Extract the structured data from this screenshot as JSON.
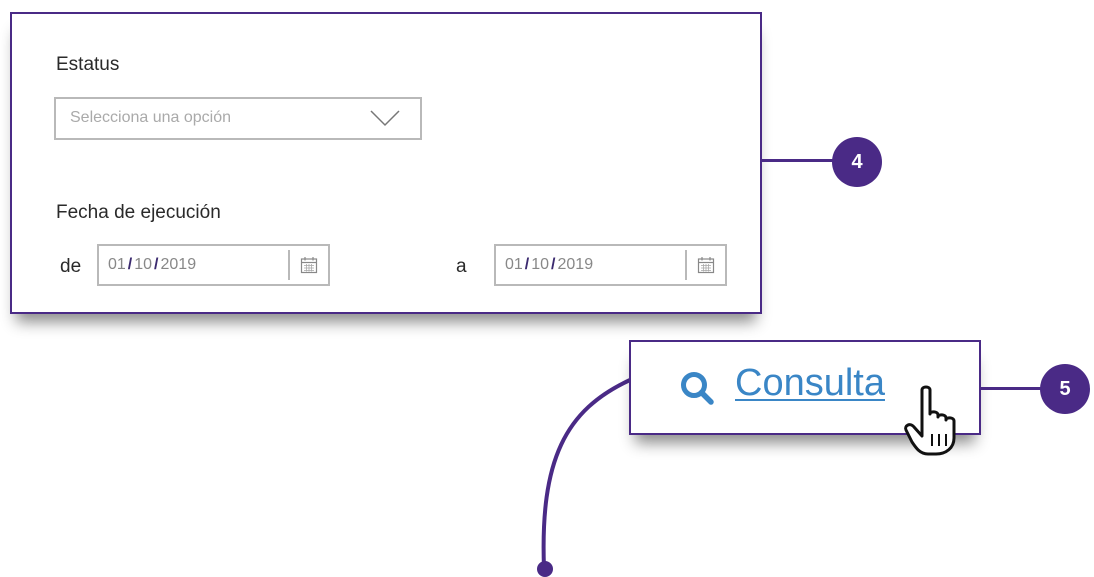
{
  "filters": {
    "status_label": "Estatus",
    "status_placeholder": "Selecciona una opción",
    "date_label": "Fecha de ejecución",
    "from_label": "de",
    "to_label": "a",
    "from_date": {
      "day": "01",
      "month": "10",
      "year": "2019",
      "separator": "/"
    },
    "to_date": {
      "day": "01",
      "month": "10",
      "year": "2019",
      "separator": "/"
    }
  },
  "callouts": {
    "step_4": "4",
    "step_5": "5"
  },
  "consulta": {
    "label": "Consulta"
  },
  "colors": {
    "accent_purple": "#4a2a86",
    "link_blue": "#3a86c6",
    "border_gray": "#b9b9b9",
    "placeholder_gray": "#aaaaaa"
  },
  "icons": [
    "chevron-down-icon",
    "calendar-icon",
    "search-icon",
    "hand-pointer-icon"
  ]
}
